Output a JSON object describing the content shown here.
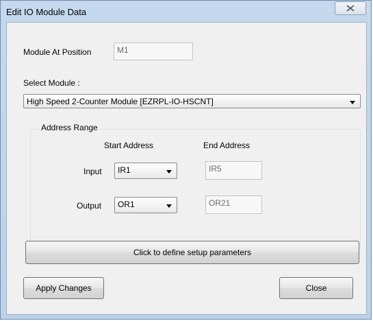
{
  "window": {
    "title": "Edit IO Module Data"
  },
  "module_position": {
    "label": "Module At Position",
    "value": "M1"
  },
  "select_module": {
    "label": "Select Module :",
    "value": "High Speed 2-Counter Module [EZRPL-IO-HSCNT]"
  },
  "address_range": {
    "title": "Address Range",
    "start_header": "Start Address",
    "end_header": "End Address",
    "input": {
      "label": "Input",
      "start": "IR1",
      "end": "IR5"
    },
    "output": {
      "label": "Output",
      "start": "OR1",
      "end": "OR21"
    }
  },
  "buttons": {
    "setup": "Click to define setup parameters",
    "apply": "Apply Changes",
    "close": "Close"
  },
  "colors": {
    "title_bar": "#bcd1ea",
    "client_bg": "#f0f0f0"
  }
}
